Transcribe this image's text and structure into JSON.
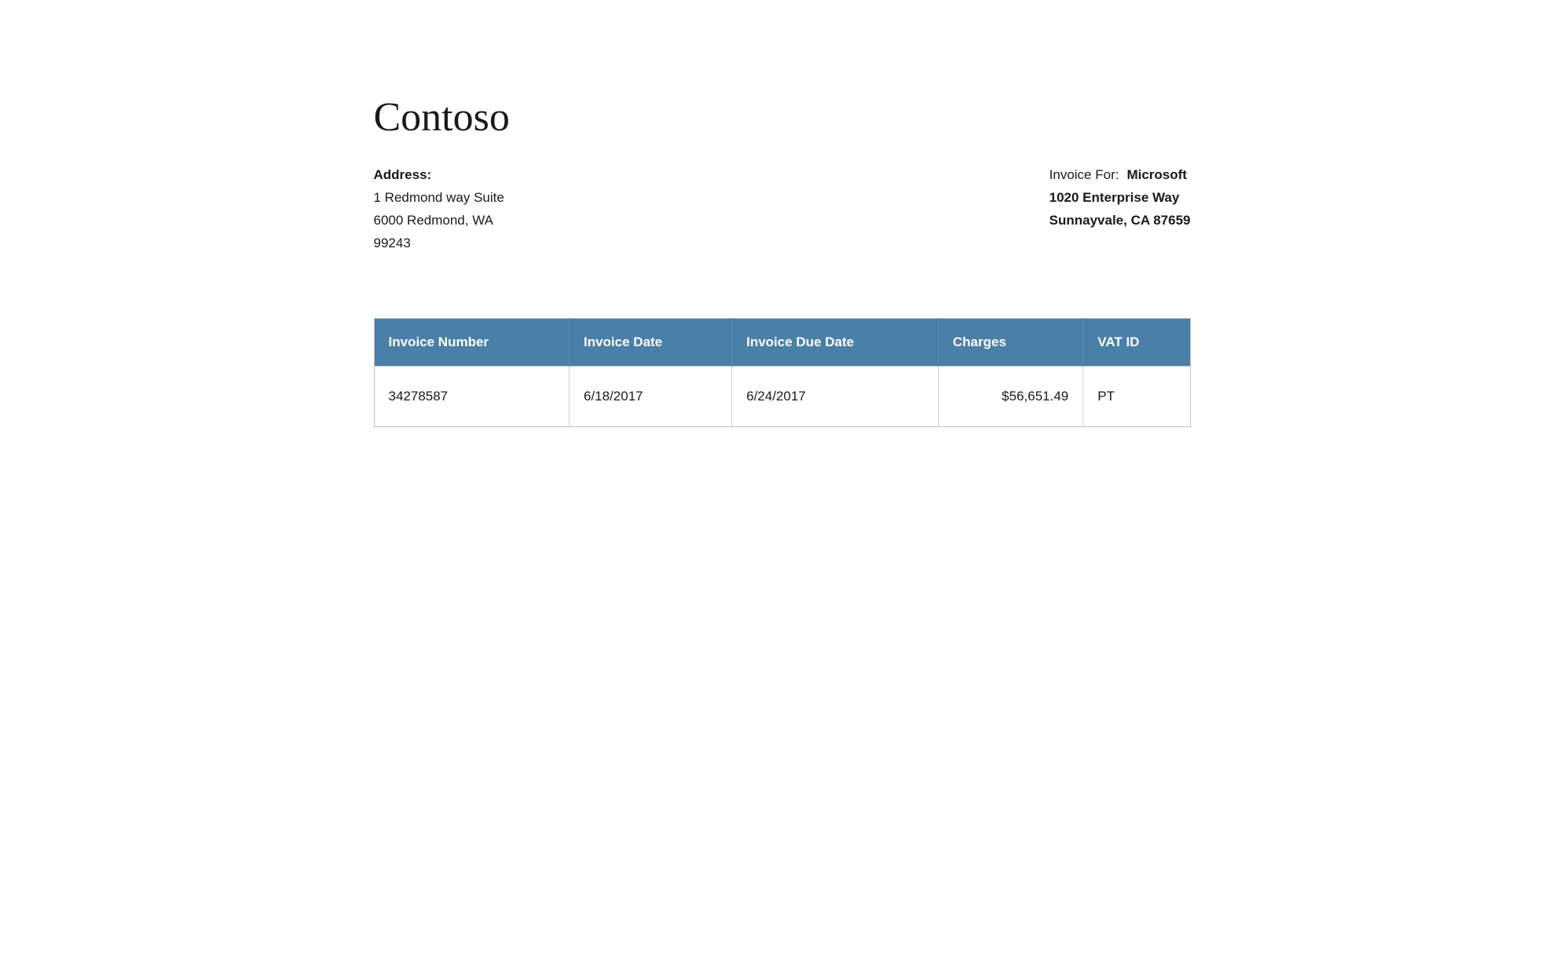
{
  "company": {
    "name": "Contoso"
  },
  "sender": {
    "address_label": "Address:",
    "line1": "1 Redmond way Suite",
    "line2": "6000 Redmond, WA",
    "line3": "99243"
  },
  "invoice_for": {
    "label": "Invoice For:",
    "company": "Microsoft",
    "address_line1": "1020 Enterprise Way",
    "address_line2": "Sunnayvale, CA 87659"
  },
  "table": {
    "headers": [
      "Invoice Number",
      "Invoice Date",
      "Invoice Due Date",
      "Charges",
      "VAT ID"
    ],
    "rows": [
      {
        "invoice_number": "34278587",
        "invoice_date": "6/18/2017",
        "invoice_due_date": "6/24/2017",
        "charges": "$56,651.49",
        "vat_id": "PT"
      }
    ]
  }
}
